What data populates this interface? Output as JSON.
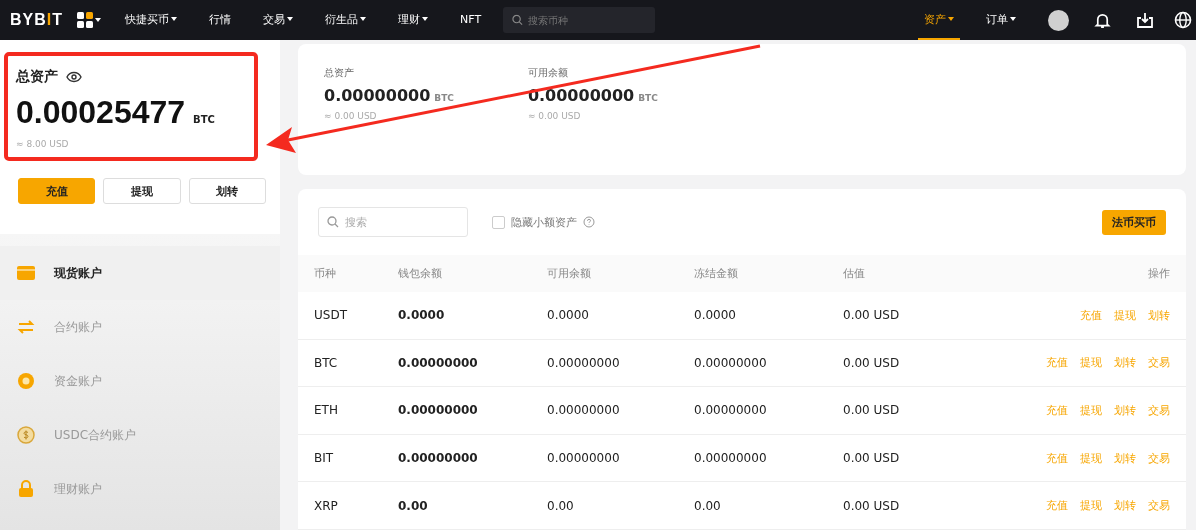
{
  "nav": {
    "logo": "BYBIT",
    "items": [
      {
        "label": "快捷买币",
        "has_menu": true
      },
      {
        "label": "行情",
        "has_menu": false
      },
      {
        "label": "交易",
        "has_menu": true
      },
      {
        "label": "衍生品",
        "has_menu": true
      },
      {
        "label": "理财",
        "has_menu": true
      },
      {
        "label": "NFT",
        "has_menu": false
      }
    ],
    "search": {
      "placeholder": "搜索币种"
    },
    "right_items": [
      {
        "label": "资产",
        "has_menu": true,
        "selected": true
      },
      {
        "label": "订单",
        "has_menu": true,
        "selected": false
      }
    ]
  },
  "summary": {
    "title": "总资产",
    "amount": "0.00025477",
    "unit": "BTC",
    "usd": "≈ 8.00 USD",
    "buttons": [
      {
        "label": "充值",
        "primary": true
      },
      {
        "label": "提现",
        "primary": false
      },
      {
        "label": "划转",
        "primary": false
      }
    ]
  },
  "sidebar": {
    "items": [
      {
        "label": "现货账户",
        "kind": "card",
        "selected": true
      },
      {
        "label": "合约账户",
        "kind": "swap",
        "selected": false
      },
      {
        "label": "资金账户",
        "kind": "coin",
        "selected": false
      },
      {
        "label": "USDC合约账户",
        "kind": "dollar",
        "selected": false
      },
      {
        "label": "理财账户",
        "kind": "lock",
        "selected": false
      }
    ]
  },
  "overview": [
    {
      "label": "总资产",
      "amount": "0.00000000",
      "unit": "BTC",
      "usd": "≈ 0.00 USD"
    },
    {
      "label": "可用余额",
      "amount": "0.00000000",
      "unit": "BTC",
      "usd": "≈ 0.00 USD"
    }
  ],
  "toolbar": {
    "search": {
      "placeholder": "搜索"
    },
    "hide_small": {
      "label": "隐藏小额资产",
      "checked": false
    },
    "buy_button": "法币买币"
  },
  "table": {
    "columns": [
      "币种",
      "钱包余额",
      "可用余额",
      "冻结金额",
      "估值",
      "操作"
    ],
    "rows": [
      {
        "cells": [
          "USDT",
          "0.0000",
          "0.0000",
          "0.0000",
          "0.00 USD"
        ],
        "actions": [
          "充值",
          "提现",
          "划转"
        ]
      },
      {
        "cells": [
          "BTC",
          "0.00000000",
          "0.00000000",
          "0.00000000",
          "0.00 USD"
        ],
        "actions": [
          "充值",
          "提现",
          "划转",
          "交易"
        ]
      },
      {
        "cells": [
          "ETH",
          "0.00000000",
          "0.00000000",
          "0.00000000",
          "0.00 USD"
        ],
        "actions": [
          "充值",
          "提现",
          "划转",
          "交易"
        ]
      },
      {
        "cells": [
          "BIT",
          "0.00000000",
          "0.00000000",
          "0.00000000",
          "0.00 USD"
        ],
        "actions": [
          "充值",
          "提现",
          "划转",
          "交易"
        ]
      },
      {
        "cells": [
          "XRP",
          "0.00",
          "0.00",
          "0.00",
          "0.00 USD"
        ],
        "actions": [
          "充值",
          "提现",
          "划转",
          "交易"
        ]
      }
    ]
  }
}
